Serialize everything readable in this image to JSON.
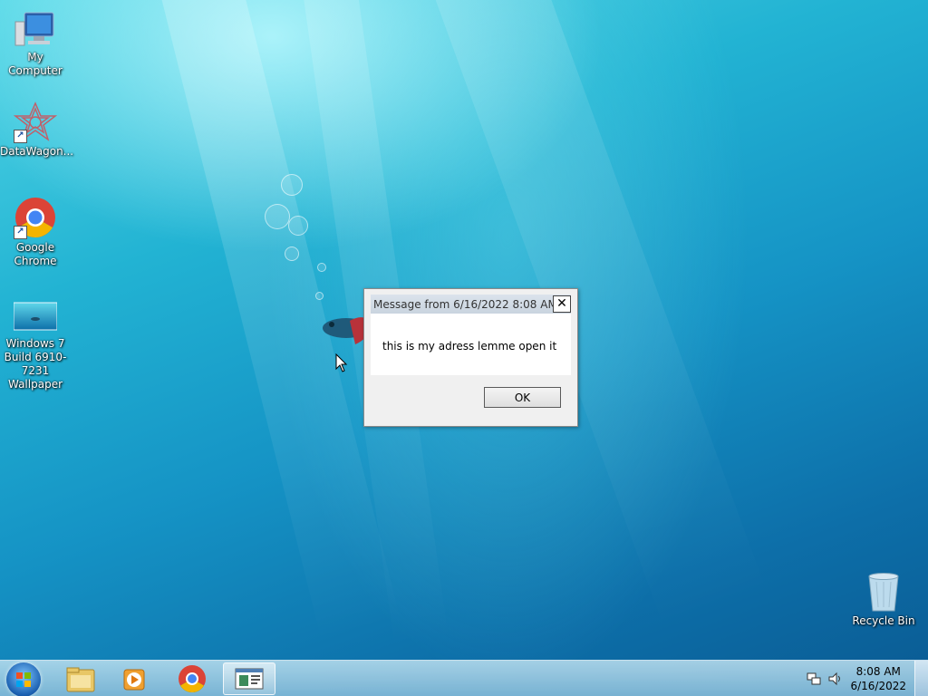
{
  "desktop": {
    "icons": [
      {
        "label": "My Computer"
      },
      {
        "label": "DataWagon..."
      },
      {
        "label": "Google Chrome"
      },
      {
        "label": "Windows 7 Build 6910-7231 Wallpaper"
      },
      {
        "label": "Recycle Bin"
      }
    ]
  },
  "dialog": {
    "title": "Message from  6/16/2022 8:08 AM",
    "close_symbol": "✕",
    "message": "this is my adress lemme open it",
    "ok_label": "OK"
  },
  "taskbar": {
    "items": [
      {
        "icon": "windows-explorer-icon"
      },
      {
        "icon": "media-player-icon"
      },
      {
        "icon": "chrome-icon"
      },
      {
        "icon": "message-window-icon",
        "active": true
      }
    ],
    "time": "8:08 AM",
    "date": "6/16/2022"
  }
}
